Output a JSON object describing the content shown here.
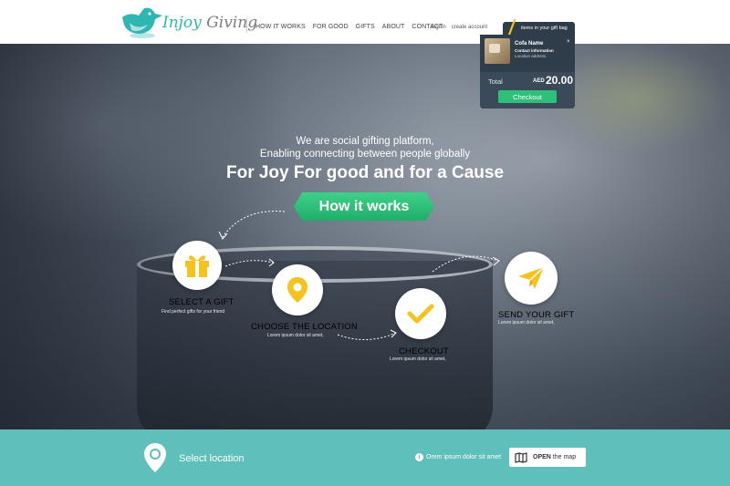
{
  "brand": {
    "name_part1": "Injoy",
    "name_part2": "Giving"
  },
  "nav": {
    "items": [
      "HOW IT WORKS",
      "FOR GOOD",
      "GIFTS",
      "ABOUT",
      "CONTACT"
    ]
  },
  "account": {
    "signin": "Signin",
    "create": "create account"
  },
  "cart": {
    "tab_label": "items in your gift bag",
    "item": {
      "name": "Cofa Name",
      "contact": "Contact information",
      "location": "Location address",
      "close": "×"
    },
    "total_label": "Total",
    "currency": "AED",
    "amount": "20.00",
    "checkout_label": "Checkout"
  },
  "hero": {
    "line1": "We are social gifting platform,",
    "line2": "Enabling connecting between people globally",
    "headline": "For Joy  For good and for a Cause",
    "cta": "How it works"
  },
  "steps": [
    {
      "title": "SELECT A GIFT",
      "subtitle": "Find perfect gifts for your friend",
      "icon": "gift-icon"
    },
    {
      "title": "CHOOSE THE LOCATION",
      "subtitle": "Lorem ipsum dolor sit amet,",
      "icon": "location-pin-icon"
    },
    {
      "title": "CHECKOUT",
      "subtitle": "Lorem ipsum dolor sit amet,",
      "icon": "checkmark-icon"
    },
    {
      "title": "SEND YOUR GIFT",
      "subtitle": "Lorem ipsum dolor sit amet,",
      "icon": "paper-plane-icon"
    }
  ],
  "footer": {
    "select_location": "Select location",
    "info_text": "Orem ipsum dolor sit amet",
    "open_map_bold": "OPEN",
    "open_map_rest": "the map"
  },
  "colors": {
    "teal": "#5ebfbb",
    "green": "#2ec07a",
    "yellow": "#f7c21d",
    "dark_panel": "#2f3d4a"
  }
}
